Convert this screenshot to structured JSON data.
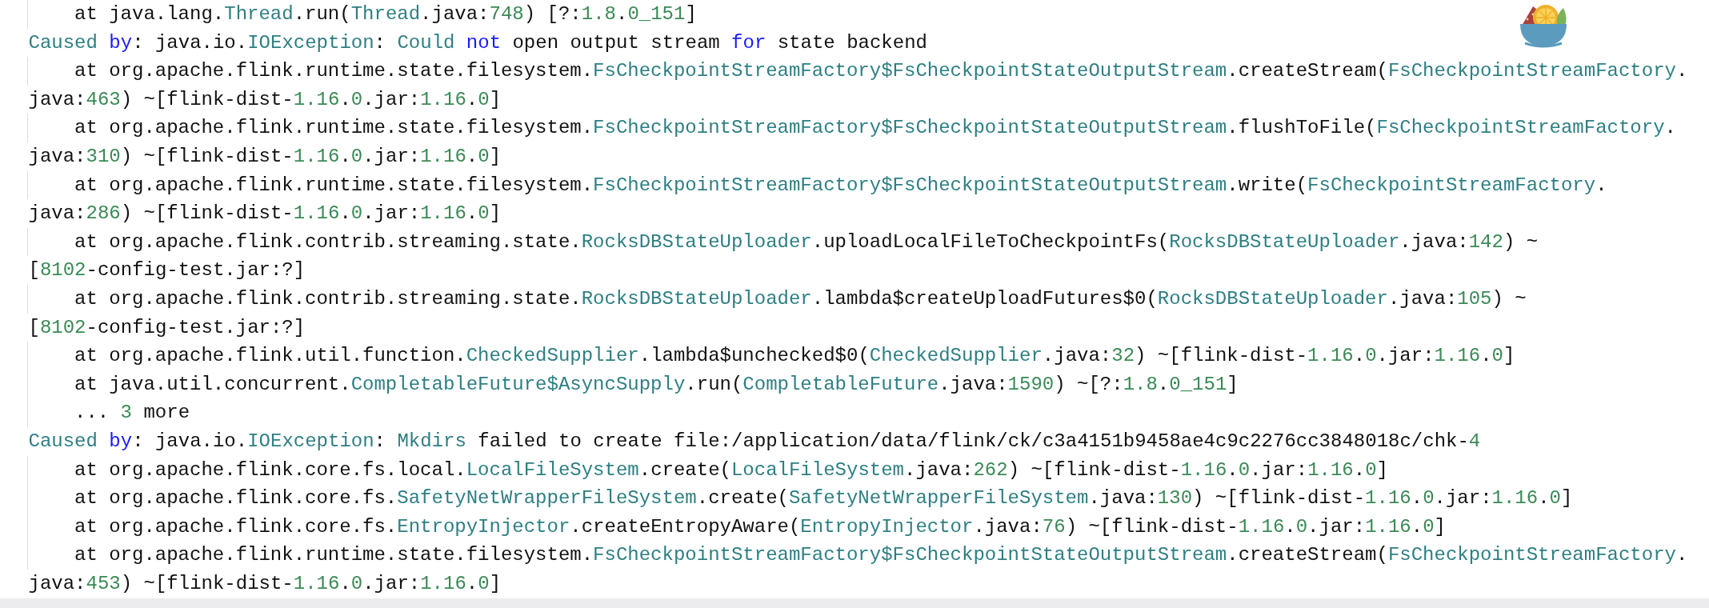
{
  "code_lines": [
    {
      "kind": "frame",
      "tokens": [
        {
          "text": "at java.lang.",
          "kind": "plain"
        },
        {
          "text": "Thread",
          "kind": "type"
        },
        {
          "text": ".run(",
          "kind": "plain"
        },
        {
          "text": "Thread",
          "kind": "type"
        },
        {
          "text": ".java:",
          "kind": "plain"
        },
        {
          "text": "748",
          "kind": "number"
        },
        {
          "text": ") [?:",
          "kind": "plain"
        },
        {
          "text": "1.8",
          "kind": "number"
        },
        {
          "text": ".",
          "kind": "plain"
        },
        {
          "text": "0_151",
          "kind": "number"
        },
        {
          "text": "]",
          "kind": "plain"
        }
      ]
    },
    {
      "kind": "cause",
      "tokens": [
        {
          "text": "Caused",
          "kind": "type"
        },
        {
          "text": " by",
          "kind": "keyword"
        },
        {
          "text": ": java.io.",
          "kind": "plain"
        },
        {
          "text": "IOException",
          "kind": "type"
        },
        {
          "text": ": ",
          "kind": "plain"
        },
        {
          "text": "Could",
          "kind": "type"
        },
        {
          "text": " not",
          "kind": "keyword"
        },
        {
          "text": " open output stream ",
          "kind": "plain"
        },
        {
          "text": "for",
          "kind": "keyword"
        },
        {
          "text": " state backend",
          "kind": "plain"
        }
      ]
    },
    {
      "kind": "frame",
      "tokens": [
        {
          "text": "at org.apache.flink.runtime.state.filesystem.",
          "kind": "plain"
        },
        {
          "text": "FsCheckpointStreamFactory$FsCheckpointStateOutputStream",
          "kind": "type"
        },
        {
          "text": ".createStream(",
          "kind": "plain"
        },
        {
          "text": "FsCheckpointStreamFactory",
          "kind": "type"
        },
        {
          "text": ".",
          "kind": "plain"
        }
      ]
    },
    {
      "kind": "continuation",
      "tokens": [
        {
          "text": "java:",
          "kind": "plain"
        },
        {
          "text": "463",
          "kind": "number"
        },
        {
          "text": ") ~[flink-dist-",
          "kind": "plain"
        },
        {
          "text": "1.16",
          "kind": "number"
        },
        {
          "text": ".",
          "kind": "plain"
        },
        {
          "text": "0",
          "kind": "number"
        },
        {
          "text": ".jar:",
          "kind": "plain"
        },
        {
          "text": "1.16",
          "kind": "number"
        },
        {
          "text": ".",
          "kind": "plain"
        },
        {
          "text": "0",
          "kind": "number"
        },
        {
          "text": "]",
          "kind": "plain"
        }
      ]
    },
    {
      "kind": "frame",
      "tokens": [
        {
          "text": "at org.apache.flink.runtime.state.filesystem.",
          "kind": "plain"
        },
        {
          "text": "FsCheckpointStreamFactory$FsCheckpointStateOutputStream",
          "kind": "type"
        },
        {
          "text": ".flushToFile(",
          "kind": "plain"
        },
        {
          "text": "FsCheckpointStreamFactory",
          "kind": "type"
        },
        {
          "text": ".",
          "kind": "plain"
        }
      ]
    },
    {
      "kind": "continuation",
      "tokens": [
        {
          "text": "java:",
          "kind": "plain"
        },
        {
          "text": "310",
          "kind": "number"
        },
        {
          "text": ") ~[flink-dist-",
          "kind": "plain"
        },
        {
          "text": "1.16",
          "kind": "number"
        },
        {
          "text": ".",
          "kind": "plain"
        },
        {
          "text": "0",
          "kind": "number"
        },
        {
          "text": ".jar:",
          "kind": "plain"
        },
        {
          "text": "1.16",
          "kind": "number"
        },
        {
          "text": ".",
          "kind": "plain"
        },
        {
          "text": "0",
          "kind": "number"
        },
        {
          "text": "]",
          "kind": "plain"
        }
      ]
    },
    {
      "kind": "frame",
      "tokens": [
        {
          "text": "at org.apache.flink.runtime.state.filesystem.",
          "kind": "plain"
        },
        {
          "text": "FsCheckpointStreamFactory$FsCheckpointStateOutputStream",
          "kind": "type"
        },
        {
          "text": ".write(",
          "kind": "plain"
        },
        {
          "text": "FsCheckpointStreamFactory",
          "kind": "type"
        },
        {
          "text": ".",
          "kind": "plain"
        }
      ]
    },
    {
      "kind": "continuation",
      "tokens": [
        {
          "text": "java:",
          "kind": "plain"
        },
        {
          "text": "286",
          "kind": "number"
        },
        {
          "text": ") ~[flink-dist-",
          "kind": "plain"
        },
        {
          "text": "1.16",
          "kind": "number"
        },
        {
          "text": ".",
          "kind": "plain"
        },
        {
          "text": "0",
          "kind": "number"
        },
        {
          "text": ".jar:",
          "kind": "plain"
        },
        {
          "text": "1.16",
          "kind": "number"
        },
        {
          "text": ".",
          "kind": "plain"
        },
        {
          "text": "0",
          "kind": "number"
        },
        {
          "text": "]",
          "kind": "plain"
        }
      ]
    },
    {
      "kind": "frame",
      "tokens": [
        {
          "text": "at org.apache.flink.contrib.streaming.state.",
          "kind": "plain"
        },
        {
          "text": "RocksDBStateUploader",
          "kind": "type"
        },
        {
          "text": ".uploadLocalFileToCheckpointFs(",
          "kind": "plain"
        },
        {
          "text": "RocksDBStateUploader",
          "kind": "type"
        },
        {
          "text": ".java:",
          "kind": "plain"
        },
        {
          "text": "142",
          "kind": "number"
        },
        {
          "text": ") ~",
          "kind": "plain"
        }
      ]
    },
    {
      "kind": "continuation",
      "tokens": [
        {
          "text": "[",
          "kind": "plain"
        },
        {
          "text": "8102",
          "kind": "number"
        },
        {
          "text": "-config-test.jar:?]",
          "kind": "plain"
        }
      ]
    },
    {
      "kind": "frame",
      "tokens": [
        {
          "text": "at org.apache.flink.contrib.streaming.state.",
          "kind": "plain"
        },
        {
          "text": "RocksDBStateUploader",
          "kind": "type"
        },
        {
          "text": ".lambda$createUploadFutures$0(",
          "kind": "plain"
        },
        {
          "text": "RocksDBStateUploader",
          "kind": "type"
        },
        {
          "text": ".java:",
          "kind": "plain"
        },
        {
          "text": "105",
          "kind": "number"
        },
        {
          "text": ") ~",
          "kind": "plain"
        }
      ]
    },
    {
      "kind": "continuation",
      "tokens": [
        {
          "text": "[",
          "kind": "plain"
        },
        {
          "text": "8102",
          "kind": "number"
        },
        {
          "text": "-config-test.jar:?]",
          "kind": "plain"
        }
      ]
    },
    {
      "kind": "frame",
      "tokens": [
        {
          "text": "at org.apache.flink.util.function.",
          "kind": "plain"
        },
        {
          "text": "CheckedSupplier",
          "kind": "type"
        },
        {
          "text": ".lambda$unchecked$0(",
          "kind": "plain"
        },
        {
          "text": "CheckedSupplier",
          "kind": "type"
        },
        {
          "text": ".java:",
          "kind": "plain"
        },
        {
          "text": "32",
          "kind": "number"
        },
        {
          "text": ") ~[flink-dist-",
          "kind": "plain"
        },
        {
          "text": "1.16",
          "kind": "number"
        },
        {
          "text": ".",
          "kind": "plain"
        },
        {
          "text": "0",
          "kind": "number"
        },
        {
          "text": ".jar:",
          "kind": "plain"
        },
        {
          "text": "1.16",
          "kind": "number"
        },
        {
          "text": ".",
          "kind": "plain"
        },
        {
          "text": "0",
          "kind": "number"
        },
        {
          "text": "]",
          "kind": "plain"
        }
      ]
    },
    {
      "kind": "frame",
      "tokens": [
        {
          "text": "at java.util.concurrent.",
          "kind": "plain"
        },
        {
          "text": "CompletableFuture$AsyncSupply",
          "kind": "type"
        },
        {
          "text": ".run(",
          "kind": "plain"
        },
        {
          "text": "CompletableFuture",
          "kind": "type"
        },
        {
          "text": ".java:",
          "kind": "plain"
        },
        {
          "text": "1590",
          "kind": "number"
        },
        {
          "text": ") ~[?:",
          "kind": "plain"
        },
        {
          "text": "1.8",
          "kind": "number"
        },
        {
          "text": ".",
          "kind": "plain"
        },
        {
          "text": "0_151",
          "kind": "number"
        },
        {
          "text": "]",
          "kind": "plain"
        }
      ]
    },
    {
      "kind": "frame",
      "tokens": [
        {
          "text": "... ",
          "kind": "plain"
        },
        {
          "text": "3",
          "kind": "number"
        },
        {
          "text": " more",
          "kind": "plain"
        }
      ]
    },
    {
      "kind": "cause",
      "tokens": [
        {
          "text": "Caused",
          "kind": "type"
        },
        {
          "text": " by",
          "kind": "keyword"
        },
        {
          "text": ": java.io.",
          "kind": "plain"
        },
        {
          "text": "IOException",
          "kind": "type"
        },
        {
          "text": ": ",
          "kind": "plain"
        },
        {
          "text": "Mkdirs",
          "kind": "type"
        },
        {
          "text": " failed to create file:/application/data/flink/ck/c3a4151b9458ae4c9c2276cc3848018c/chk-",
          "kind": "plain"
        },
        {
          "text": "4",
          "kind": "number"
        }
      ]
    },
    {
      "kind": "frame",
      "tokens": [
        {
          "text": "at org.apache.flink.core.fs.local.",
          "kind": "plain"
        },
        {
          "text": "LocalFileSystem",
          "kind": "type"
        },
        {
          "text": ".create(",
          "kind": "plain"
        },
        {
          "text": "LocalFileSystem",
          "kind": "type"
        },
        {
          "text": ".java:",
          "kind": "plain"
        },
        {
          "text": "262",
          "kind": "number"
        },
        {
          "text": ") ~[flink-dist-",
          "kind": "plain"
        },
        {
          "text": "1.16",
          "kind": "number"
        },
        {
          "text": ".",
          "kind": "plain"
        },
        {
          "text": "0",
          "kind": "number"
        },
        {
          "text": ".jar:",
          "kind": "plain"
        },
        {
          "text": "1.16",
          "kind": "number"
        },
        {
          "text": ".",
          "kind": "plain"
        },
        {
          "text": "0",
          "kind": "number"
        },
        {
          "text": "]",
          "kind": "plain"
        }
      ]
    },
    {
      "kind": "frame",
      "tokens": [
        {
          "text": "at org.apache.flink.core.fs.",
          "kind": "plain"
        },
        {
          "text": "SafetyNetWrapperFileSystem",
          "kind": "type"
        },
        {
          "text": ".create(",
          "kind": "plain"
        },
        {
          "text": "SafetyNetWrapperFileSystem",
          "kind": "type"
        },
        {
          "text": ".java:",
          "kind": "plain"
        },
        {
          "text": "130",
          "kind": "number"
        },
        {
          "text": ") ~[flink-dist-",
          "kind": "plain"
        },
        {
          "text": "1.16",
          "kind": "number"
        },
        {
          "text": ".",
          "kind": "plain"
        },
        {
          "text": "0",
          "kind": "number"
        },
        {
          "text": ".jar:",
          "kind": "plain"
        },
        {
          "text": "1.16",
          "kind": "number"
        },
        {
          "text": ".",
          "kind": "plain"
        },
        {
          "text": "0",
          "kind": "number"
        },
        {
          "text": "]",
          "kind": "plain"
        }
      ]
    },
    {
      "kind": "frame",
      "tokens": [
        {
          "text": "at org.apache.flink.core.fs.",
          "kind": "plain"
        },
        {
          "text": "EntropyInjector",
          "kind": "type"
        },
        {
          "text": ".createEntropyAware(",
          "kind": "plain"
        },
        {
          "text": "EntropyInjector",
          "kind": "type"
        },
        {
          "text": ".java:",
          "kind": "plain"
        },
        {
          "text": "76",
          "kind": "number"
        },
        {
          "text": ") ~[flink-dist-",
          "kind": "plain"
        },
        {
          "text": "1.16",
          "kind": "number"
        },
        {
          "text": ".",
          "kind": "plain"
        },
        {
          "text": "0",
          "kind": "number"
        },
        {
          "text": ".jar:",
          "kind": "plain"
        },
        {
          "text": "1.16",
          "kind": "number"
        },
        {
          "text": ".",
          "kind": "plain"
        },
        {
          "text": "0",
          "kind": "number"
        },
        {
          "text": "]",
          "kind": "plain"
        }
      ]
    },
    {
      "kind": "frame",
      "tokens": [
        {
          "text": "at org.apache.flink.runtime.state.filesystem.",
          "kind": "plain"
        },
        {
          "text": "FsCheckpointStreamFactory$FsCheckpointStateOutputStream",
          "kind": "type"
        },
        {
          "text": ".createStream(",
          "kind": "plain"
        },
        {
          "text": "FsCheckpointStreamFactory",
          "kind": "type"
        },
        {
          "text": ".",
          "kind": "plain"
        }
      ]
    },
    {
      "kind": "continuation",
      "tokens": [
        {
          "text": "java:",
          "kind": "plain"
        },
        {
          "text": "453",
          "kind": "number"
        },
        {
          "text": ") ~[flink-dist-",
          "kind": "plain"
        },
        {
          "text": "1.16",
          "kind": "number"
        },
        {
          "text": ".",
          "kind": "plain"
        },
        {
          "text": "0",
          "kind": "number"
        },
        {
          "text": ".jar:",
          "kind": "plain"
        },
        {
          "text": "1.16",
          "kind": "number"
        },
        {
          "text": ".",
          "kind": "plain"
        },
        {
          "text": "0",
          "kind": "number"
        },
        {
          "text": "]",
          "kind": "plain"
        }
      ]
    }
  ]
}
